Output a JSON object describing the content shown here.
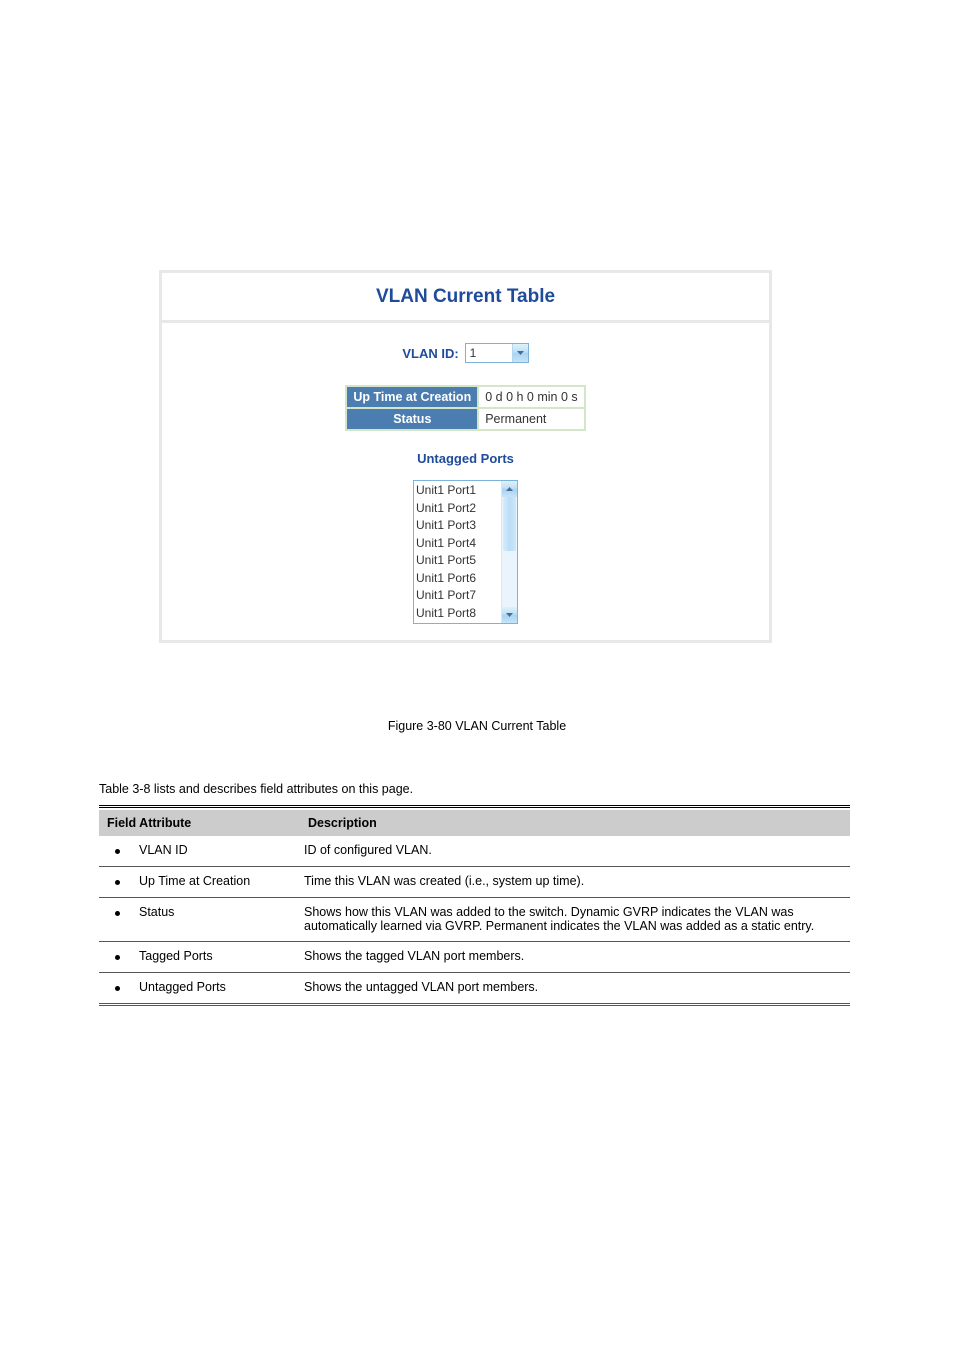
{
  "panel": {
    "title": "VLAN Current Table",
    "vlan_id_label": "VLAN ID:",
    "vlan_id_value": "1",
    "info": {
      "uptime_label": "Up Time at Creation",
      "uptime_value": "0 d 0 h 0 min 0 s",
      "status_label": "Status",
      "status_value": "Permanent"
    },
    "untagged_heading": "Untagged Ports",
    "untagged_ports": [
      "Unit1 Port1",
      "Unit1 Port2",
      "Unit1 Port3",
      "Unit1 Port4",
      "Unit1 Port5",
      "Unit1 Port6",
      "Unit1 Port7",
      "Unit1 Port8"
    ]
  },
  "figure_caption": "Figure 3-80   VLAN Current Table",
  "table_caption": "Table 3-8 lists and describes field attributes on this page.",
  "attributes": {
    "header_field": "Field Attribute",
    "header_desc": "Description",
    "rows": [
      {
        "label": "VLAN ID",
        "desc": "ID of configured VLAN."
      },
      {
        "label": "Up Time at Creation",
        "desc": "Time this VLAN was created (i.e., system up time)."
      },
      {
        "label": "Status",
        "desc": "Shows how this VLAN was added to the switch. Dynamic GVRP indicates the VLAN was automatically learned via GVRP. Permanent indicates the VLAN was added as a static entry."
      },
      {
        "label": "Tagged Ports",
        "desc": "Shows the tagged VLAN port members."
      },
      {
        "label": "Untagged Ports",
        "desc": "Shows the untagged VLAN port members."
      }
    ]
  }
}
